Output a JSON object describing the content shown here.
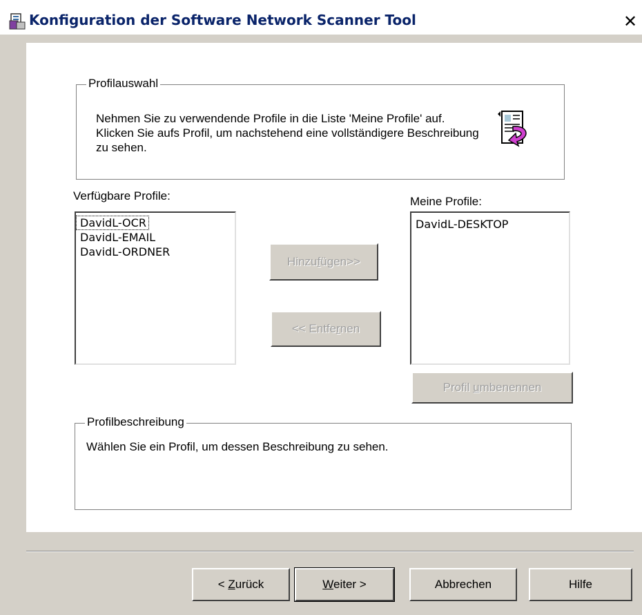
{
  "window": {
    "title": "Konfiguration der Software Network Scanner Tool",
    "close_glyph": "✕"
  },
  "profile_selection": {
    "legend": "Profilauswahl",
    "info_text": "Nehmen Sie zu verwendende Profile in die Liste 'Meine Profile' auf. Klicken Sie aufs Profil, um nachstehend eine vollständigere Beschreibung zu sehen.",
    "icon": "document-arrow-icon"
  },
  "available_profiles": {
    "label": "Verfügbare Profile:",
    "items": [
      "DavidL-OCR",
      "DavidL-EMAIL",
      "DavidL-ORDNER"
    ]
  },
  "my_profiles": {
    "label": "Meine Profile:",
    "items": [
      "DavidL-DESKTOP"
    ]
  },
  "buttons": {
    "add": {
      "pre": "Hinzu",
      "accel": "f",
      "post": "ügen>>",
      "disabled": true
    },
    "remove": {
      "pre": "<< Entfe",
      "accel": "r",
      "post": "nen",
      "disabled": true
    },
    "rename": {
      "pre": "Profil ",
      "accel": "u",
      "post": "mbenennen",
      "disabled": true
    }
  },
  "description": {
    "legend": "Profilbeschreibung",
    "text": "Wählen Sie ein Profil, um dessen Beschreibung zu sehen."
  },
  "footer": {
    "back": {
      "pre": "< ",
      "accel": "Z",
      "post": "urück"
    },
    "next": {
      "pre": "",
      "accel": "W",
      "post": "eiter >"
    },
    "cancel": "Abbrechen",
    "help": "Hilfe"
  },
  "colors": {
    "title_text": "#0a246a",
    "dialog_face": "#d4d0c8",
    "disabled_text": "#a0a0a0"
  }
}
